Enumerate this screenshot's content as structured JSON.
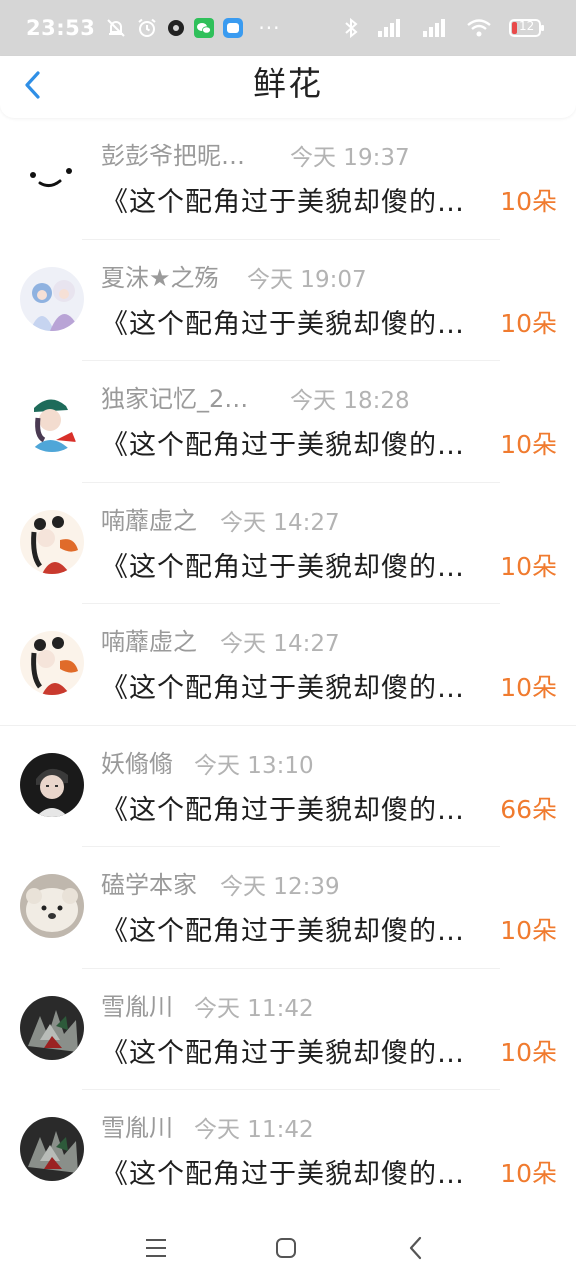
{
  "status_bar": {
    "time": "23:53",
    "battery": "12",
    "more": "···"
  },
  "header": {
    "title": "鲜花"
  },
  "items": [
    {
      "name": "彭彭爷把昵…",
      "time": "今天 19:37",
      "message": "《这个配角过于美貌却傻的…",
      "amount": "10朵"
    },
    {
      "name": "夏沫★之殇",
      "time": "今天 19:07",
      "message": "《这个配角过于美貌却傻的…",
      "amount": "10朵"
    },
    {
      "name": "独家记忆_2…",
      "time": "今天 18:28",
      "message": "《这个配角过于美貌却傻的…",
      "amount": "10朵"
    },
    {
      "name": "喃蘼虚之",
      "time": "今天 14:27",
      "message": "《这个配角过于美貌却傻的…",
      "amount": "10朵"
    },
    {
      "name": "喃蘼虚之",
      "time": "今天 14:27",
      "message": "《这个配角过于美貌却傻的…",
      "amount": "10朵"
    },
    {
      "name": "妖翛翛",
      "time": "今天 13:10",
      "message": "《这个配角过于美貌却傻的…",
      "amount": "66朵"
    },
    {
      "name": "磕学本家",
      "time": "今天 12:39",
      "message": "《这个配角过于美貌却傻的…",
      "amount": "10朵"
    },
    {
      "name": "雪胤川",
      "time": "今天 11:42",
      "message": "《这个配角过于美貌却傻的…",
      "amount": "10朵"
    },
    {
      "name": "雪胤川",
      "time": "今天 11:42",
      "message": "《这个配角过于美貌却傻的…",
      "amount": "10朵"
    }
  ],
  "colors": {
    "accent": "#2f8fe6",
    "amount": "#f07b2f"
  }
}
